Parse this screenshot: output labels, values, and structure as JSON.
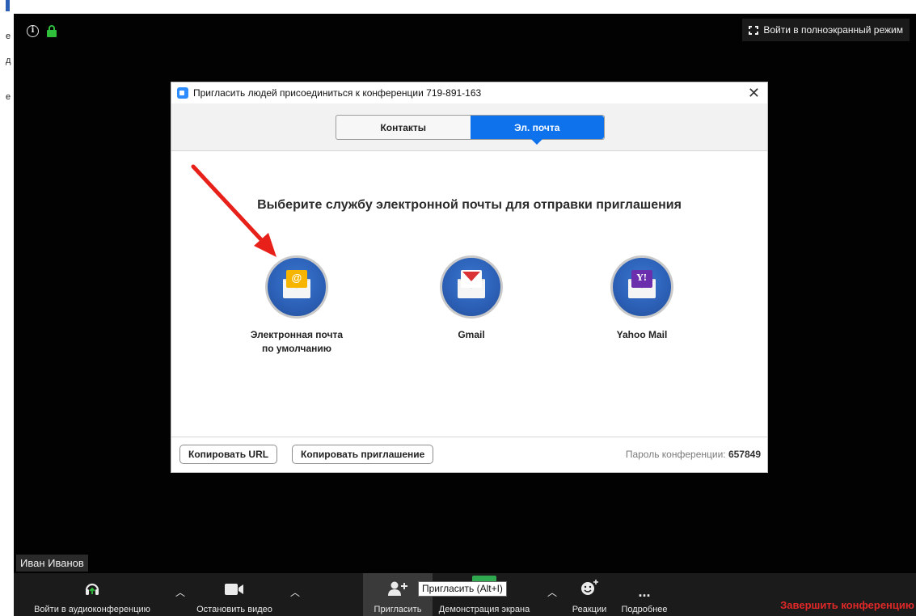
{
  "background_fragments": [
    "e",
    "д",
    "e"
  ],
  "meeting": {
    "fullscreen_label": "Войти в полноэкранный режим",
    "participant_name": "Иван Иванов"
  },
  "dialog": {
    "title": "Пригласить людей присоединиться к конференции 719-891-163",
    "tabs": [
      "Контакты",
      "Эл. почта"
    ],
    "active_tab": "Эл. почта",
    "heading": "Выберите службу электронной почты для отправки приглашения",
    "services": [
      {
        "label_line1": "Электронная почта",
        "label_line2": "по умолчанию",
        "icon": "default-mail-icon",
        "glyph": "@"
      },
      {
        "label_line1": "Gmail",
        "label_line2": "",
        "icon": "gmail-icon",
        "glyph": ""
      },
      {
        "label_line1": "Yahoo Mail",
        "label_line2": "",
        "icon": "yahoo-mail-icon",
        "glyph": "Y!"
      }
    ],
    "copy_url_label": "Копировать URL",
    "copy_invite_label": "Копировать приглашение",
    "password_label": "Пароль конференции:",
    "password_value": "657849"
  },
  "toolbar": {
    "audio_label": "Войти в аудиоконференцию",
    "video_label": "Остановить видео",
    "invite_label": "Пригласить",
    "share_label": "Демонстрация экрана",
    "reactions_label": "Реакции",
    "more_label": "Подробнее",
    "end_label": "Завершить конференцию",
    "tooltip": "Пригласить (Alt+I)",
    "more_glyph": "..."
  },
  "colors": {
    "accent_blue": "#0e72ed",
    "end_red": "#e02828",
    "annotation_arrow": "#e8201a"
  }
}
